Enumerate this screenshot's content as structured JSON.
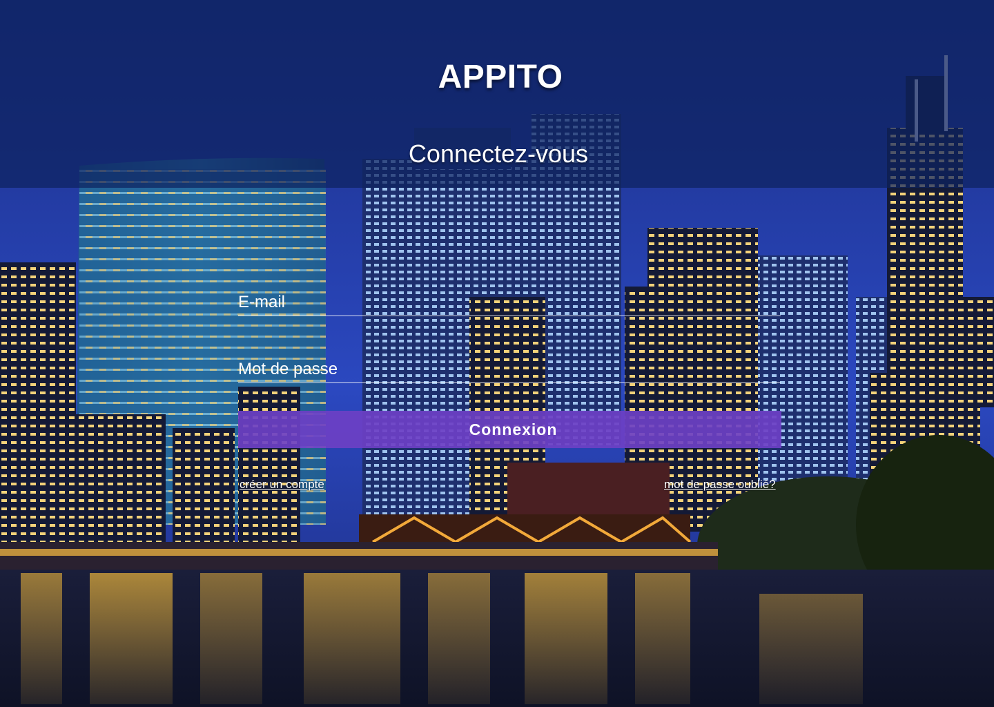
{
  "brand": {
    "name": "APPITO"
  },
  "login": {
    "heading": "Connectez-vous",
    "email_placeholder": "E-mail",
    "password_placeholder": "Mot de passe",
    "submit_label": "Connexion",
    "create_account_link": "créer un compte",
    "forgot_password_link": "mot de passe oublié?"
  },
  "colors": {
    "accent": "#6d40c4",
    "header_overlay": "#0e2260",
    "text": "#ffffff"
  }
}
